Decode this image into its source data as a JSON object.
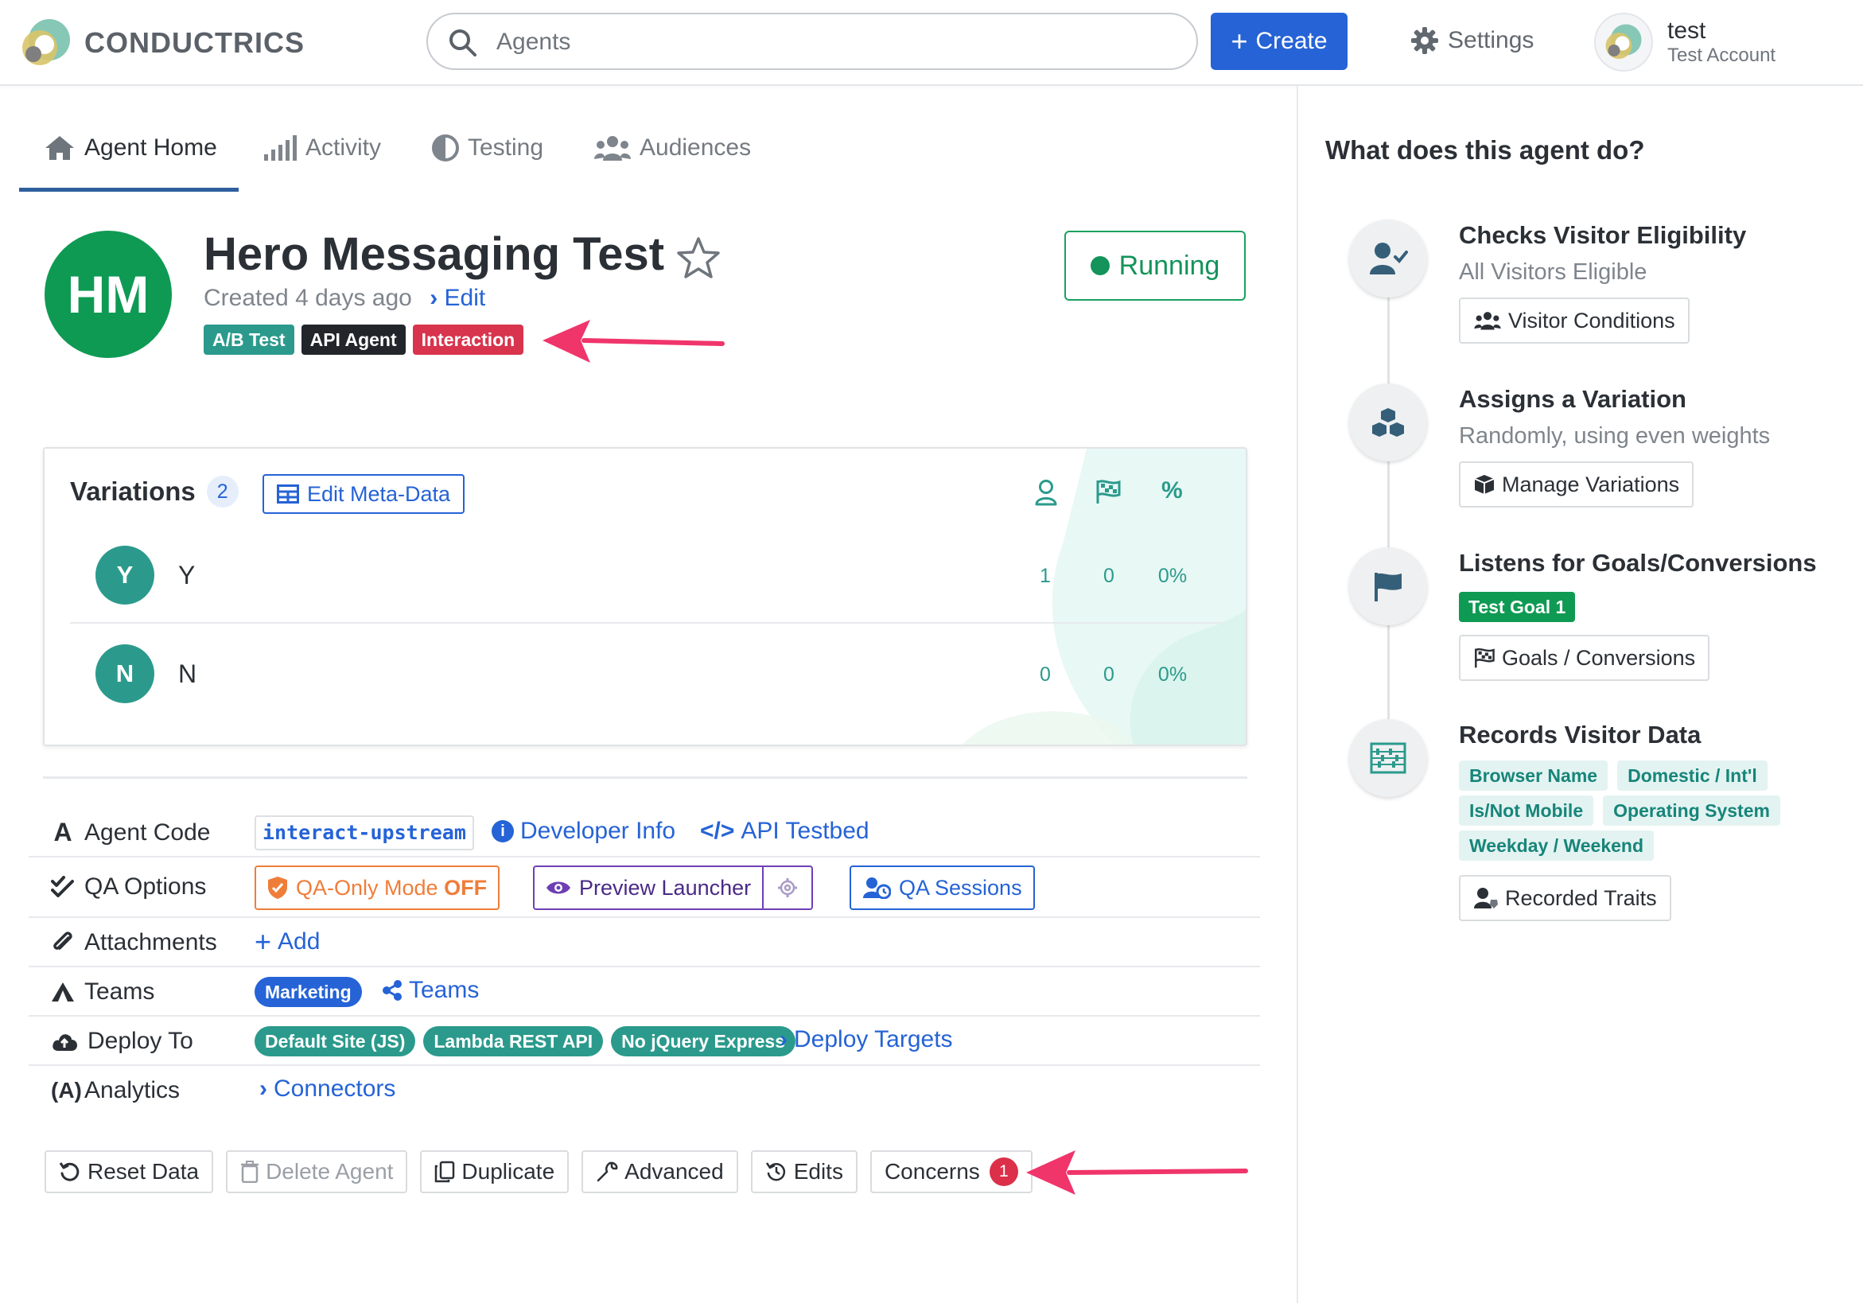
{
  "header": {
    "brand": "CONDUCTRICS",
    "search_placeholder": "Agents",
    "create_label": "Create",
    "settings_label": "Settings",
    "user_name": "test",
    "user_account": "Test Account"
  },
  "tabs": [
    {
      "label": "Agent Home",
      "active": true
    },
    {
      "label": "Activity",
      "active": false
    },
    {
      "label": "Testing",
      "active": false
    },
    {
      "label": "Audiences",
      "active": false
    }
  ],
  "agent": {
    "initials": "HM",
    "title": "Hero Messaging Test",
    "created": "Created 4 days ago",
    "edit_label": "Edit",
    "status": "Running",
    "badges": [
      {
        "label": "A/B Test",
        "color": "#2b9a8c"
      },
      {
        "label": "API Agent",
        "color": "#22252a"
      },
      {
        "label": "Interaction",
        "color": "#d8344d"
      }
    ]
  },
  "variations": {
    "title": "Variations",
    "count": "2",
    "edit_meta_label": "Edit Meta-Data",
    "columns": [
      "visitors-icon",
      "goals-icon",
      "%"
    ],
    "rows": [
      {
        "initial": "Y",
        "name": "Y",
        "visitors": "1",
        "goals": "0",
        "rate": "0%"
      },
      {
        "initial": "N",
        "name": "N",
        "visitors": "0",
        "goals": "0",
        "rate": "0%"
      }
    ]
  },
  "info": {
    "agent_code_label": "Agent Code",
    "agent_code_value": "interact-upstream",
    "developer_info": "Developer Info",
    "api_testbed": "API Testbed",
    "qa_options_label": "QA Options",
    "qa_mode_prefix": "QA-Only Mode",
    "qa_mode_state": "OFF",
    "preview_launcher": "Preview Launcher",
    "qa_sessions": "QA Sessions",
    "attachments_label": "Attachments",
    "add_label": "Add",
    "teams_label": "Teams",
    "team_pill": "Marketing",
    "teams_link": "Teams",
    "deploy_label": "Deploy To",
    "deploy_pills": [
      "Default Site (JS)",
      "Lambda REST API",
      "No jQuery Express"
    ],
    "deploy_targets": "Deploy Targets",
    "analytics_label": "Analytics",
    "connectors": "Connectors"
  },
  "actions": {
    "reset": "Reset Data",
    "delete": "Delete Agent",
    "duplicate": "Duplicate",
    "advanced": "Advanced",
    "edits": "Edits",
    "concerns": "Concerns",
    "concerns_count": "1"
  },
  "sidebar": {
    "title": "What does this agent do?",
    "steps": [
      {
        "title": "Checks Visitor Eligibility",
        "subtitle": "All Visitors Eligible",
        "button": "Visitor Conditions"
      },
      {
        "title": "Assigns a Variation",
        "subtitle": "Randomly, using even weights",
        "button": "Manage Variations"
      },
      {
        "title": "Listens for Goals/Conversions",
        "tag": "Test Goal 1",
        "button": "Goals / Conversions"
      },
      {
        "title": "Records Visitor Data",
        "traits": [
          "Browser Name",
          "Domestic / Int'l",
          "Is/Not Mobile",
          "Operating System",
          "Weekday / Weekend"
        ],
        "button": "Recorded Traits"
      }
    ]
  },
  "colors": {
    "primary": "#2563d6",
    "success": "#0f9a54",
    "teal": "#2b9a8c",
    "danger": "#d8344d",
    "annotation_arrow": "#f0356b"
  }
}
